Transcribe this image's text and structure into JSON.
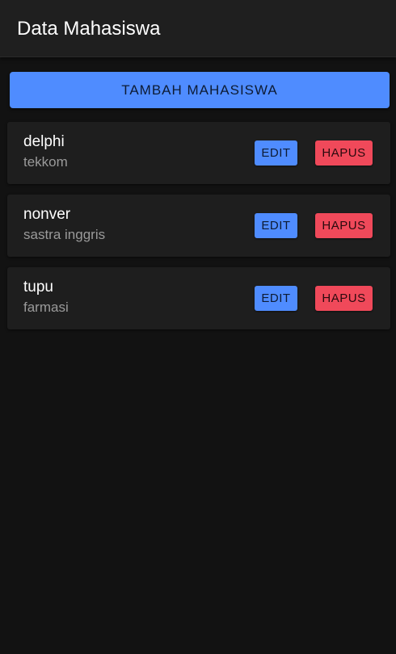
{
  "header": {
    "title": "Data Mahasiswa"
  },
  "actions": {
    "add_label": "TAMBAH MAHASISWA"
  },
  "students": [
    {
      "name": "delphi",
      "department": "tekkom",
      "edit_label": "EDIT",
      "delete_label": "HAPUS"
    },
    {
      "name": "nonver",
      "department": "sastra inggris",
      "edit_label": "EDIT",
      "delete_label": "HAPUS"
    },
    {
      "name": "tupu",
      "department": "farmasi",
      "edit_label": "EDIT",
      "delete_label": "HAPUS"
    }
  ],
  "colors": {
    "background": "#121212",
    "header": "#1f1f1f",
    "card": "#1e1e1e",
    "primary": "#4f8cff",
    "danger": "#f0495a"
  }
}
